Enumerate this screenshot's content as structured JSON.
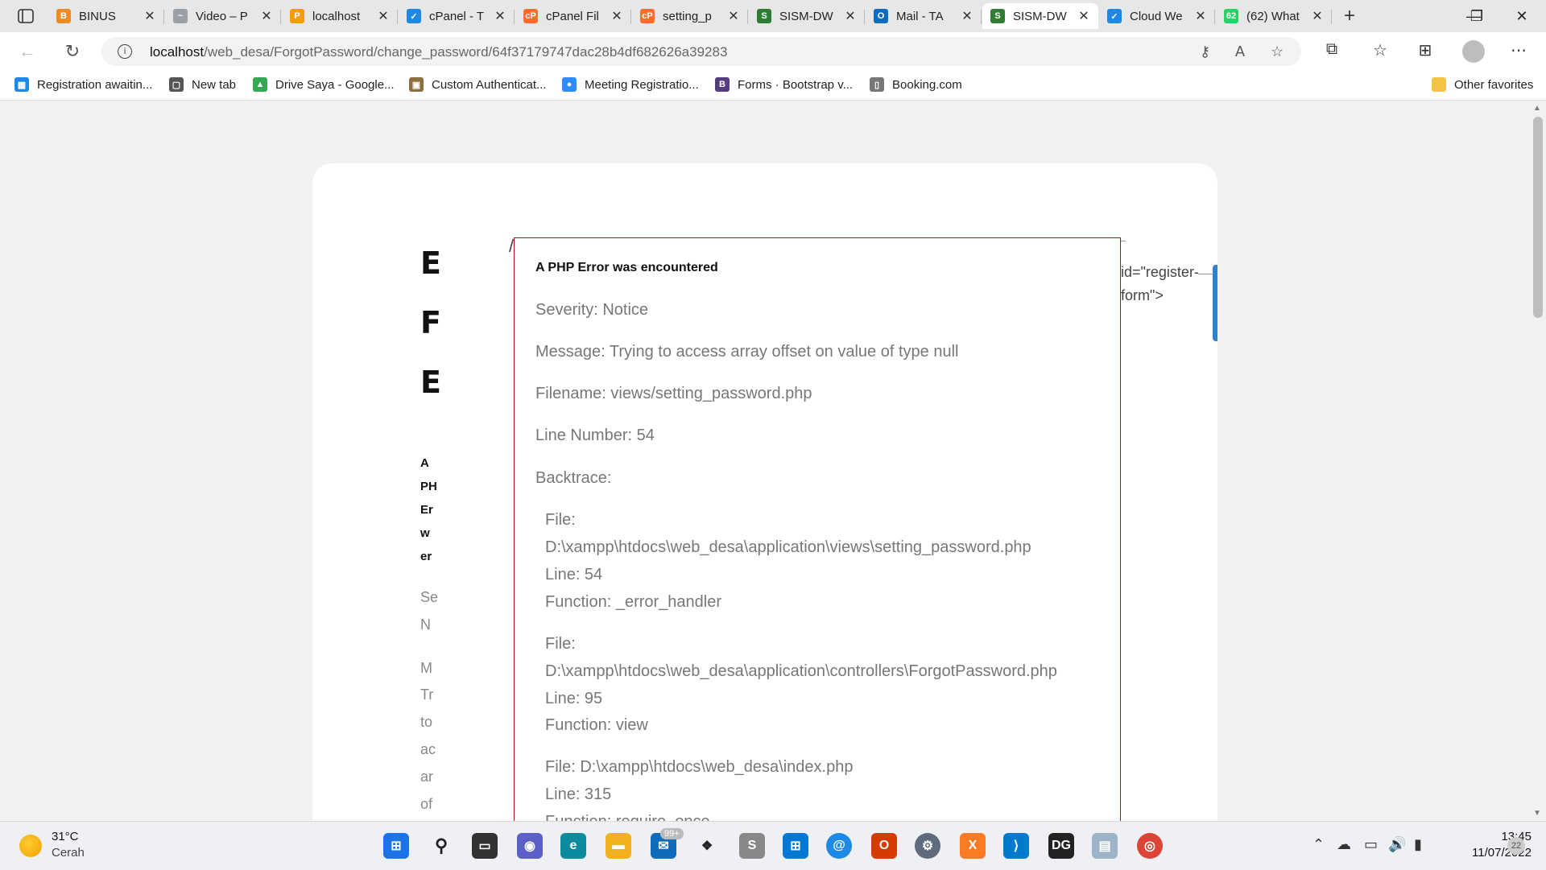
{
  "browser": {
    "tabs": [
      {
        "label": "BINUS",
        "color": "#f08a24",
        "glyph": "B"
      },
      {
        "label": "Video – P",
        "color": "#9aa0a6",
        "glyph": "~"
      },
      {
        "label": "localhost",
        "color": "#f39c12",
        "glyph": "P"
      },
      {
        "label": "cPanel - T",
        "color": "#1e88e5",
        "glyph": "✓"
      },
      {
        "label": "cPanel Fil",
        "color": "#ff6c2c",
        "glyph": "cP"
      },
      {
        "label": "setting_p",
        "color": "#ff6c2c",
        "glyph": "cP"
      },
      {
        "label": "SISM-DW",
        "color": "#2e7d32",
        "glyph": "S"
      },
      {
        "label": "Mail - TA",
        "color": "#0f6cbd",
        "glyph": "O"
      },
      {
        "label": "SISM-DW",
        "color": "#2e7d32",
        "glyph": "S"
      },
      {
        "label": "Cloud We",
        "color": "#1e88e5",
        "glyph": "✓"
      },
      {
        "label": "(62) What",
        "color": "#25d366",
        "glyph": "62"
      }
    ],
    "close_glyph": "✕",
    "newtab_glyph": "+",
    "window": {
      "minimize": "—",
      "maximize": "❐",
      "close": "✕"
    },
    "url_host": "localhost",
    "url_path": "/web_desa/ForgotPassword/change_password/64f37179747dac28b4df682626a39283",
    "favorites": [
      {
        "label": "Registration awaitin...",
        "color": "#1e88e5",
        "glyph": "▦"
      },
      {
        "label": "New tab",
        "color": "#555",
        "glyph": "▢"
      },
      {
        "label": "Drive Saya - Google...",
        "color": "#34a853",
        "glyph": "▲"
      },
      {
        "label": "Custom Authenticat...",
        "color": "#8d6e3f",
        "glyph": "▣"
      },
      {
        "label": "Meeting Registratio...",
        "color": "#2d8cff",
        "glyph": "●"
      },
      {
        "label": "Forms · Bootstrap v...",
        "color": "#563d7c",
        "glyph": "B"
      },
      {
        "label": "Booking.com",
        "color": "#777",
        "glyph": "▯"
      }
    ],
    "other_favorites": "Other favorites"
  },
  "page": {
    "big_letters": [
      "E",
      "F",
      "E"
    ],
    "left_bold": [
      "A",
      "PH",
      "Er",
      "w",
      "er"
    ],
    "left_grey": [
      "Se",
      "N",
      "M",
      "Tr",
      "to",
      "ac",
      "ar",
      "of"
    ],
    "stray_slash": "/",
    "stray_text_1": "id=\"register-",
    "stray_text_2": "form\">"
  },
  "error": {
    "title": "A PHP Error was encountered",
    "severity": "Severity: Notice",
    "message": "Message: Trying to access array offset on value of type null",
    "filename": "Filename: views/setting_password.php",
    "line_number": "Line Number: 54",
    "backtrace_label": "Backtrace:",
    "backtrace": [
      "File:",
      "D:\\xampp\\htdocs\\web_desa\\application\\views\\setting_password.php",
      "Line: 54",
      "Function: _error_handler",
      "File:",
      "D:\\xampp\\htdocs\\web_desa\\application\\controllers\\ForgotPassword.php",
      "Line: 95",
      "Function: view",
      "File: D:\\xampp\\htdocs\\web_desa\\index.php",
      "Line: 315",
      "Function: require_once"
    ]
  },
  "taskbar": {
    "temperature": "31°C",
    "weather": "Cerah",
    "mail_badge": "99+",
    "time": "13:45",
    "date": "11/07/2022",
    "notifications": "22"
  }
}
